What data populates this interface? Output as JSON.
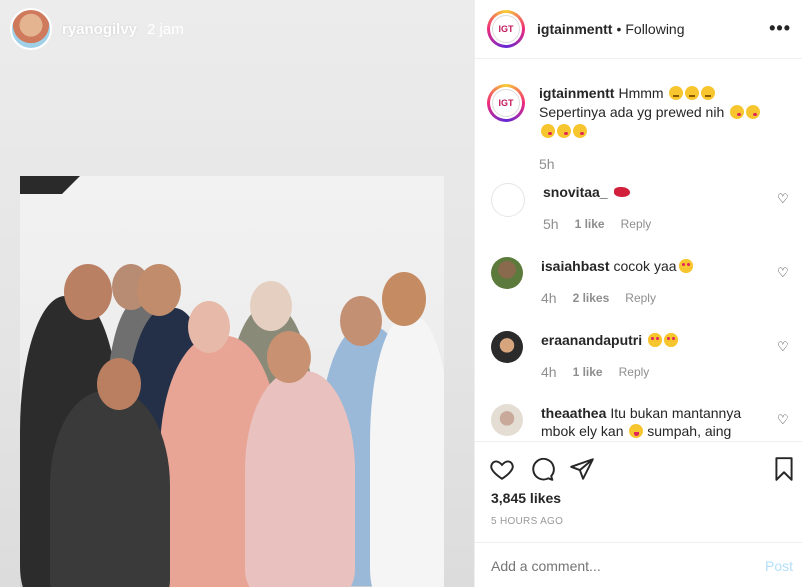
{
  "story": {
    "username": "ryanogilvy",
    "time": "2 jam"
  },
  "post": {
    "header": {
      "username": "igtainmentt",
      "separator": "•",
      "follow_status": "Following",
      "more": "•••",
      "avatar_text": "IGT"
    },
    "caption": {
      "username": "igtainmentt",
      "text_1": "Hmmm",
      "text_2": "Sepertinya ada yg prewed nih",
      "time": "5h"
    },
    "comments": [
      {
        "username": "snovitaa_",
        "text": "",
        "time": "5h",
        "likes": "1 like",
        "reply": "Reply"
      },
      {
        "username": "isaiahbast",
        "text": "cocok yaa",
        "time": "4h",
        "likes": "2 likes",
        "reply": "Reply"
      },
      {
        "username": "eraanandaputri",
        "text": "",
        "time": "4h",
        "likes": "1 like",
        "reply": "Reply"
      },
      {
        "username": "theaathea",
        "text": "Itu bukan mantannya mbok ely kan",
        "text_2": "sumpah, aing",
        "time": "",
        "likes": "",
        "reply": ""
      }
    ],
    "likes": "3,845 likes",
    "posted_ago": "5 HOURS AGO",
    "add_comment_placeholder": "Add a comment...",
    "post_button": "Post"
  },
  "colors": {
    "accent": "#0095f6",
    "post_disabled": "#b2dffc",
    "border": "#efefef",
    "muted": "#8e8e8e"
  }
}
